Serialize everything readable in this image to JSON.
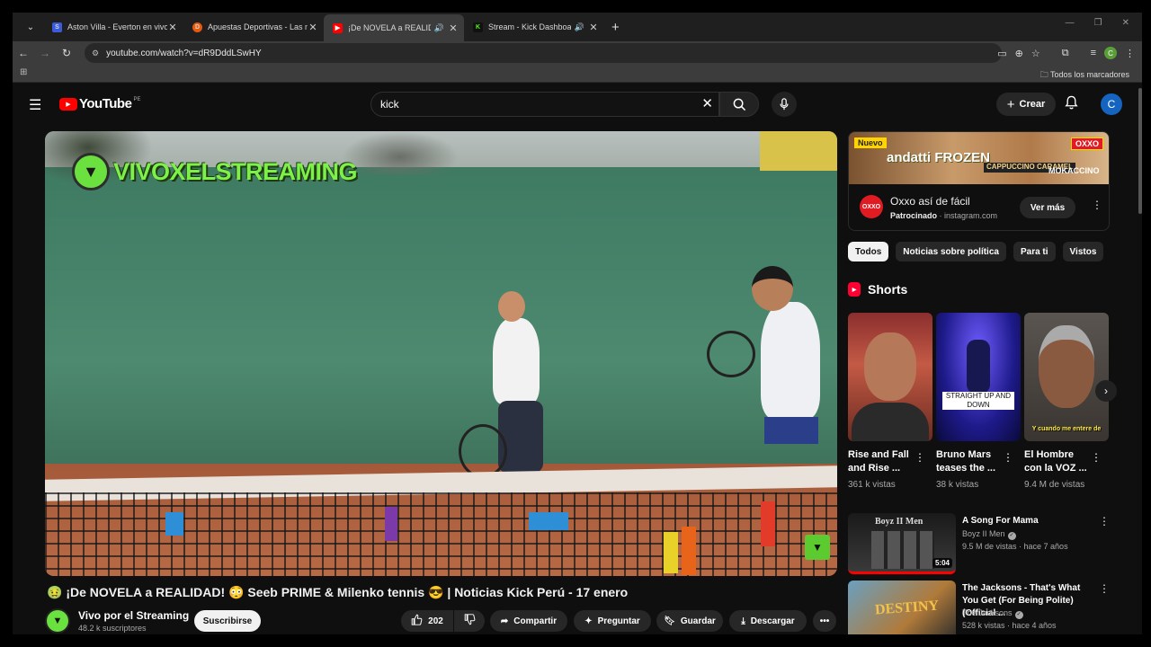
{
  "browser": {
    "tabs": [
      {
        "title": "Aston Villa - Everton en vivo, re",
        "favicon_color": "#3b5bdb",
        "audio": false
      },
      {
        "title": "Apuestas Deportivas - Las mejo",
        "favicon_color": "#e8590c",
        "audio": false
      },
      {
        "title": "¡De NOVELA a REALIDAD",
        "favicon_color": "#ff0000",
        "audio": true
      },
      {
        "title": "Stream - Kick Dashboard",
        "favicon_color": "#53fc18",
        "audio": true
      }
    ],
    "active_tab": 2,
    "url": "youtube.com/watch?v=dR9DddLSwHY",
    "bookmarks_label": "Todos los marcadores",
    "profile_initial": "C"
  },
  "yt": {
    "logo_text": "YouTube",
    "country_code": "PE",
    "search_value": "kick",
    "create_label": "Crear",
    "avatar_initial": "C"
  },
  "video": {
    "overlay_brand": "VIVOXELSTREAMING",
    "title": "🤢 ¡De NOVELA a REALIDAD! 😳 Seeb PRIME & Milenko tennis 😎 | Noticias Kick Perú - 17 enero",
    "channel": "Vivo por el Streaming",
    "subscribers": "48.2 k suscriptores",
    "subscribe_label": "Suscribirse",
    "likes": "202",
    "share_label": "Compartir",
    "ask_label": "Preguntar",
    "save_label": "Guardar",
    "download_label": "Descargar"
  },
  "ad": {
    "banner_new": "Nuevo",
    "banner_brand": "andatti FROZEN",
    "banner_flavor1": "CAPPUCCINO CARAMEL",
    "banner_flavor2": "MOKACCINO",
    "banner_logo": "OXXO",
    "title": "Oxxo así de fácil",
    "sponsored": "Patrocinado",
    "domain": "· instagram.com",
    "cta": "Ver más"
  },
  "chips": [
    "Todos",
    "Noticias sobre política",
    "Para ti",
    "Vistos"
  ],
  "shorts": {
    "heading": "Shorts",
    "items": [
      {
        "title": "Rise and Fall and Rise ...",
        "views": "361 k vistas",
        "caption": ""
      },
      {
        "title": "Bruno Mars teases the ...",
        "views": "38 k vistas",
        "caption": "STRAIGHT UP AND DOWN"
      },
      {
        "title": "El Hombre con la VOZ ...",
        "views": "9.4 M de vistas",
        "caption": "Y cuando me entere de"
      }
    ]
  },
  "recommendations": [
    {
      "title": "A Song For Mama",
      "channel": "Boyz II Men",
      "meta": "9.5 M de vistas · hace 7 años",
      "duration": "5:04",
      "thumb_text": "Boyz II Men"
    },
    {
      "title": "The Jacksons - That's What You Get (For Being Polite) (Official ...",
      "channel": "The Jacksons",
      "meta": "528 k vistas · hace 4 años",
      "duration": "",
      "thumb_text": "DESTINY"
    }
  ]
}
